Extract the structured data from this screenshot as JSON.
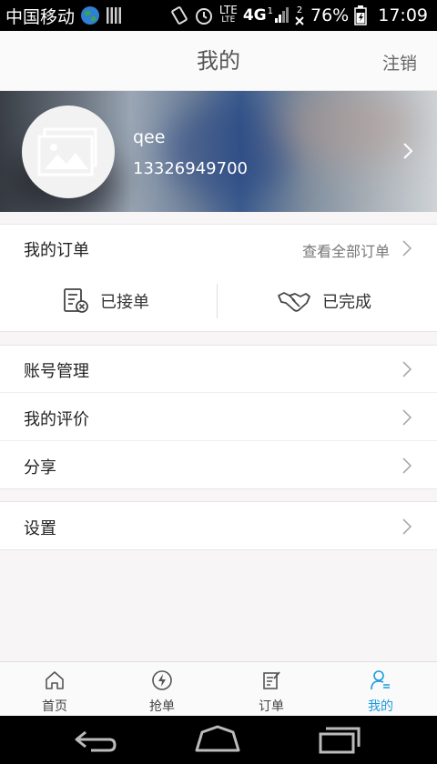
{
  "status_bar": {
    "carrier": "中国移动",
    "net_top": "LTE",
    "net_bottom": "LTE",
    "net_type": "4G",
    "sim1": "1",
    "sim2": "2",
    "battery": "76%",
    "time": "17:09"
  },
  "header": {
    "title": "我的",
    "logout_label": "注销"
  },
  "profile": {
    "username": "qee",
    "phone": "13326949700"
  },
  "orders": {
    "label": "我的订单",
    "view_all": "查看全部订单",
    "accepted_label": "已接单",
    "completed_label": "已完成"
  },
  "menu": {
    "account": "账号管理",
    "reviews": "我的评价",
    "share": "分享",
    "settings": "设置"
  },
  "tabbar": {
    "items": [
      {
        "label": "首页",
        "icon": "home-icon"
      },
      {
        "label": "抢单",
        "icon": "lightning-icon"
      },
      {
        "label": "订单",
        "icon": "order-icon"
      },
      {
        "label": "我的",
        "icon": "user-icon"
      }
    ],
    "active": "我的",
    "active_color": "#1a9be0"
  }
}
